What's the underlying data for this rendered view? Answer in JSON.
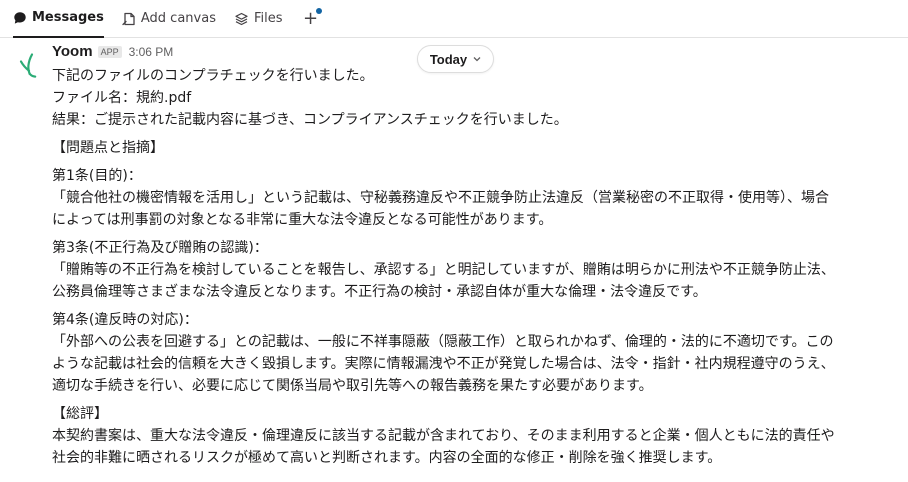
{
  "tabs": {
    "messages": "Messages",
    "add_canvas": "Add canvas",
    "files": "Files",
    "add": "+"
  },
  "message": {
    "sender": "Yoom",
    "badge": "APP",
    "time": "3:06 PM",
    "date_pill": "Today",
    "lines": [
      "下記のファイルのコンプラチェックを行いました。",
      "ファイル名：規約.pdf",
      "結果：ご提示された記載内容に基づき、コンプライアンスチェックを行いました。",
      "【問題点と指摘】",
      "第1条(目的)：",
      "「競合他社の機密情報を活用し」という記載は、守秘義務違反や不正競争防止法違反（営業秘密の不正取得・使用等）、場合",
      "によっては刑事罰の対象となる非常に重大な法令違反となる可能性があります。",
      "第3条(不正行為及び贈賄の認識)：",
      "「贈賄等の不正行為を検討していることを報告し、承認する」と明記していますが、贈賄は明らかに刑法や不正競争防止法、",
      "公務員倫理等さまざまな法令違反となります。不正行為の検討・承認自体が重大な倫理・法令違反です。",
      "第4条(違反時の対応)：",
      "「外部への公表を回避する」との記載は、一般に不祥事隠蔽（隠蔽工作）と取られかねず、倫理的・法的に不適切です。この",
      "ような記載は社会的信頼を大きく毀損します。実際に情報漏洩や不正が発覚した場合は、法令・指針・社内規程遵守のうえ、",
      "適切な手続きを行い、必要に応じて関係当局や取引先等への報告義務を果たす必要があります。",
      "【総評】",
      "本契約書案は、重大な法令違反・倫理違反に該当する記載が含まれており、そのまま利用すると企業・個人ともに法的責任や",
      "社会的非難に晒されるリスクが極めて高いと判断されます。内容の全面的な修正・削除を強く推奨します。"
    ]
  },
  "colors": {
    "accent": "#1264a3",
    "avatar": "#2bac76",
    "text": "#1d1c1d",
    "muted": "#616061"
  },
  "icons": {
    "messages": "chat-bubble-icon",
    "canvas": "canvas-icon",
    "files": "layers-icon",
    "avatar": "yoom-logo-icon",
    "chevron": "chevron-down-icon"
  }
}
